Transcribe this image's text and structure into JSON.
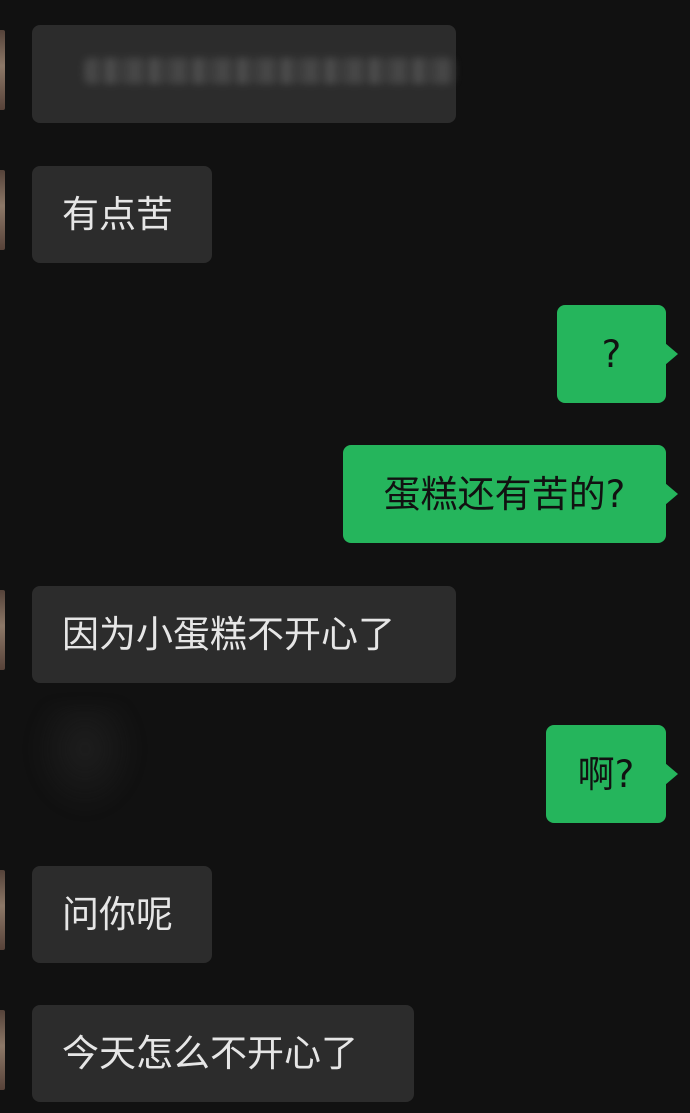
{
  "colors": {
    "background": "#111111",
    "incoming_bubble": "#2c2c2c",
    "incoming_text": "#e6e6e6",
    "outgoing_bubble": "#25b55c",
    "outgoing_text": "#111111"
  },
  "messages": [
    {
      "side": "incoming",
      "text": "",
      "blurred": true
    },
    {
      "side": "incoming",
      "text": "有点苦"
    },
    {
      "side": "outgoing",
      "text": "?"
    },
    {
      "side": "outgoing",
      "text": "蛋糕还有苦的?"
    },
    {
      "side": "incoming",
      "text": "因为小蛋糕不开心了"
    },
    {
      "side": "outgoing",
      "text": "啊?"
    },
    {
      "side": "incoming",
      "text": "问你呢"
    },
    {
      "side": "incoming",
      "text": "今天怎么不开心了"
    }
  ]
}
